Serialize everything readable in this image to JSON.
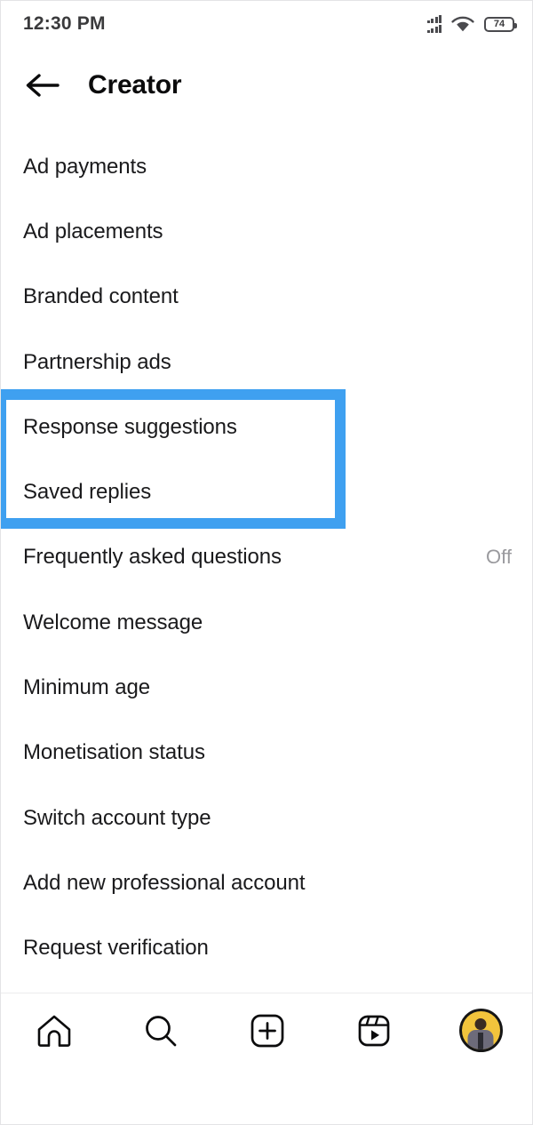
{
  "status_bar": {
    "time": "12:30 PM",
    "signal_icon": "signal-bars-dual-icon",
    "wifi_icon": "wifi-icon",
    "battery_icon": "battery-icon",
    "battery_level": "74"
  },
  "header": {
    "back_icon": "back-arrow-icon",
    "title": "Creator"
  },
  "menu": {
    "items": [
      {
        "label": "Ad payments",
        "value": ""
      },
      {
        "label": "Ad placements",
        "value": ""
      },
      {
        "label": "Branded content",
        "value": ""
      },
      {
        "label": "Partnership ads",
        "value": ""
      },
      {
        "label": "Response suggestions",
        "value": ""
      },
      {
        "label": "Saved replies",
        "value": ""
      },
      {
        "label": "Frequently asked questions",
        "value": "Off"
      },
      {
        "label": "Welcome message",
        "value": ""
      },
      {
        "label": "Minimum age",
        "value": ""
      },
      {
        "label": "Monetisation status",
        "value": ""
      },
      {
        "label": "Switch account type",
        "value": ""
      },
      {
        "label": "Add new professional account",
        "value": ""
      },
      {
        "label": "Request verification",
        "value": ""
      }
    ]
  },
  "highlight": {
    "color": "#3fa0f0",
    "covers": [
      "Response suggestions",
      "Saved replies"
    ]
  },
  "bottom_nav": {
    "items": [
      {
        "icon": "home-icon"
      },
      {
        "icon": "search-icon"
      },
      {
        "icon": "create-plus-icon"
      },
      {
        "icon": "reels-icon"
      },
      {
        "icon": "profile-avatar-icon"
      }
    ]
  }
}
